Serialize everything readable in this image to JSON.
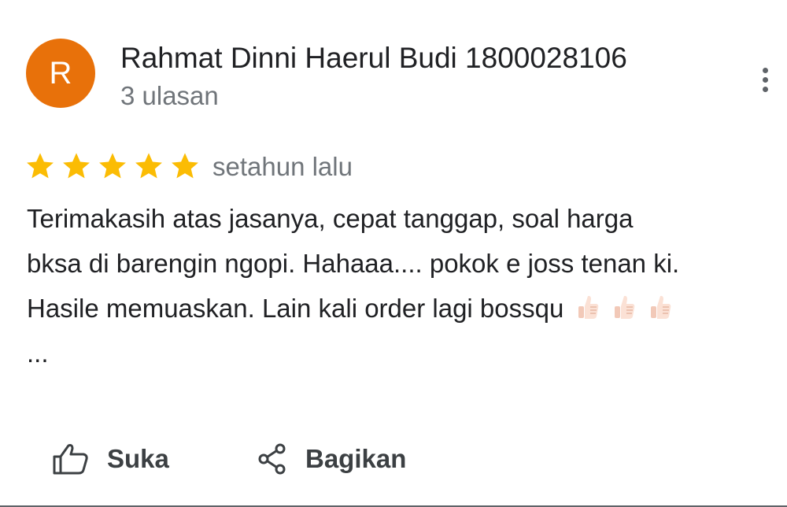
{
  "review": {
    "author": {
      "initial": "R",
      "name": "Rahmat Dinni Haerul Budi 1800028106",
      "review_count": "3 ulasan",
      "avatar_color": "#e8710a"
    },
    "rating": 5,
    "max_rating": 5,
    "star_color": "#fbbc04",
    "time": "setahun lalu",
    "text_lines": [
      "Terimakasih atas jasanya, cepat tanggap, soal harga",
      "bksa di barengin ngopi. Hahaaa.... pokok e joss tenan ki.",
      "Hasile memuaskan. Lain kali order lagi bossqu",
      "..."
    ],
    "emoji": [
      "thumbs-up-emoji",
      "thumbs-up-emoji",
      "thumbs-up-emoji"
    ]
  },
  "actions": {
    "like_label": "Suka",
    "like_icon": "thumb-up-icon",
    "share_label": "Bagikan",
    "share_icon": "share-icon"
  },
  "menu_icon": "more-vert-icon"
}
